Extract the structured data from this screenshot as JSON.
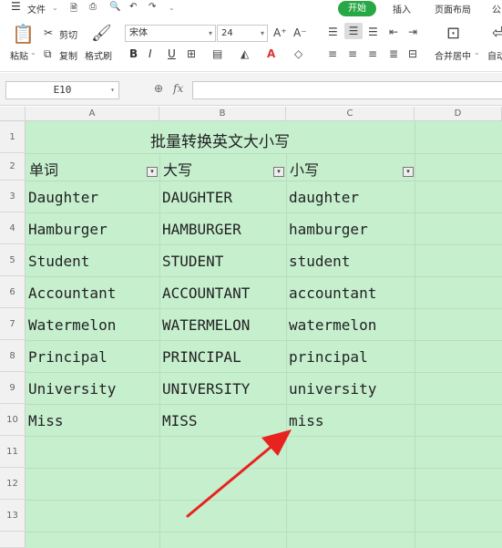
{
  "menu": {
    "hamburger_icon": "menu-icon",
    "file": "文件",
    "start_tab": "开始",
    "insert_tab": "插入",
    "layout_tab": "页面布局",
    "formula_tab": "公"
  },
  "ribbon": {
    "paste": "粘贴",
    "cut": "剪切",
    "copy": "复制",
    "format_painter": "格式刷",
    "font_name": "宋体",
    "font_size": "24",
    "bold": "B",
    "italic": "I",
    "underline": "U",
    "merge": "合并居中",
    "autowrap": "自动"
  },
  "formula_bar": {
    "name_box": "E10",
    "fx": "fx"
  },
  "columns": [
    "A",
    "B",
    "C",
    "D"
  ],
  "rows": [
    "1",
    "2",
    "3",
    "4",
    "5",
    "6",
    "7",
    "8",
    "9",
    "10",
    "11",
    "12",
    "13"
  ],
  "sheet": {
    "title": "批量转换英文大小写",
    "headers": [
      "单词",
      "大写",
      "小写"
    ],
    "data": [
      [
        "Daughter",
        "DAUGHTER",
        "daughter"
      ],
      [
        "Hamburger",
        "HAMBURGER",
        "hamburger"
      ],
      [
        "Student",
        "STUDENT",
        "student"
      ],
      [
        "Accountant",
        "ACCOUNTANT",
        "accountant"
      ],
      [
        "Watermelon",
        "WATERMELON",
        "watermelon"
      ],
      [
        "Principal",
        "PRINCIPAL",
        "principal"
      ],
      [
        "University",
        "UNIVERSITY",
        "university"
      ],
      [
        "Miss",
        "MISS",
        "miss"
      ]
    ]
  },
  "colors": {
    "accent": "#27a844",
    "cell_fill": "#c6efce",
    "arrow": "#e8231f"
  }
}
